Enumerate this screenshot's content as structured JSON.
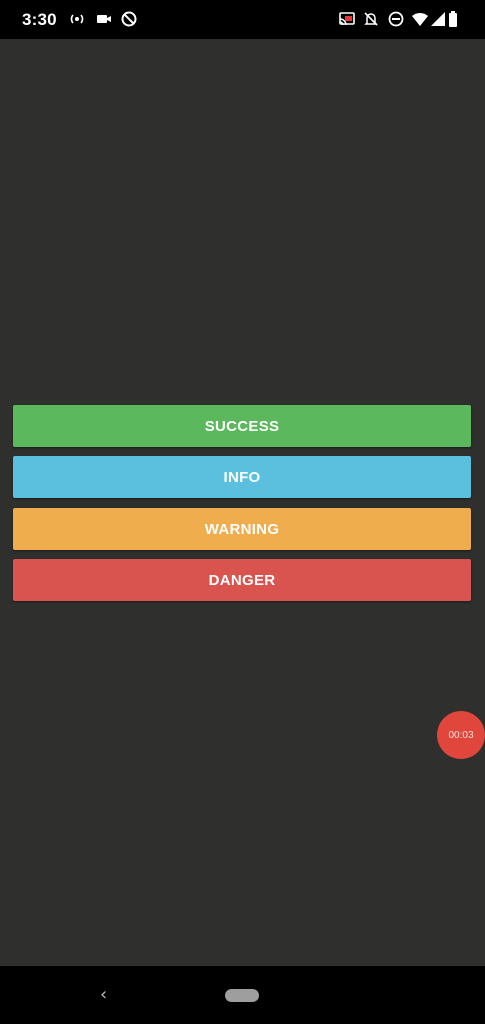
{
  "status_bar": {
    "time": "3:30",
    "left_icons": [
      "radio-waves-icon",
      "video-camera-icon",
      "no-sync-icon"
    ],
    "right_icons": [
      "cast-icon",
      "notifications-off-icon",
      "do-not-disturb-icon",
      "wifi-icon",
      "signal-icon",
      "battery-icon"
    ]
  },
  "buttons": [
    {
      "label": "SUCCESS",
      "color": "#5cb85c"
    },
    {
      "label": "INFO",
      "color": "#5bc0de"
    },
    {
      "label": "WARNING",
      "color": "#f0ad4e"
    },
    {
      "label": "DANGER",
      "color": "#d9534f"
    }
  ],
  "timer": {
    "text": "00:03",
    "color": "#e0463c"
  },
  "nav": {
    "back_icon": "chevron-left-icon",
    "home_icon": "home-pill-icon"
  }
}
